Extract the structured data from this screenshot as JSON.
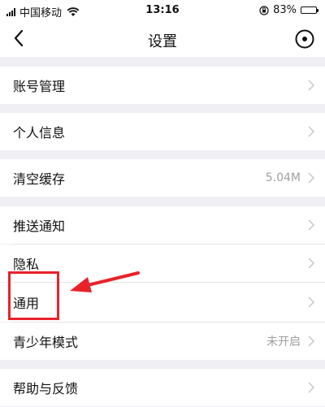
{
  "status_bar": {
    "carrier": "中国移动",
    "time": "13:16",
    "battery_text": "83%",
    "battery_level": 0.83
  },
  "nav": {
    "title": "设置",
    "back_icon": "chevron-left-icon",
    "more_icon": "circle-dot-icon"
  },
  "settings": {
    "account": "账号管理",
    "personal_info": "个人信息",
    "clear_cache": "清空缓存",
    "cache_size": "5.04M",
    "push": "推送通知",
    "privacy": "隐私",
    "general": "通用",
    "teen_mode": "青少年模式",
    "teen_mode_status": "未开启",
    "help": "帮助与反馈"
  },
  "annotation": {
    "box_color": "#e8222b",
    "arrow_color": "#e8222b"
  }
}
